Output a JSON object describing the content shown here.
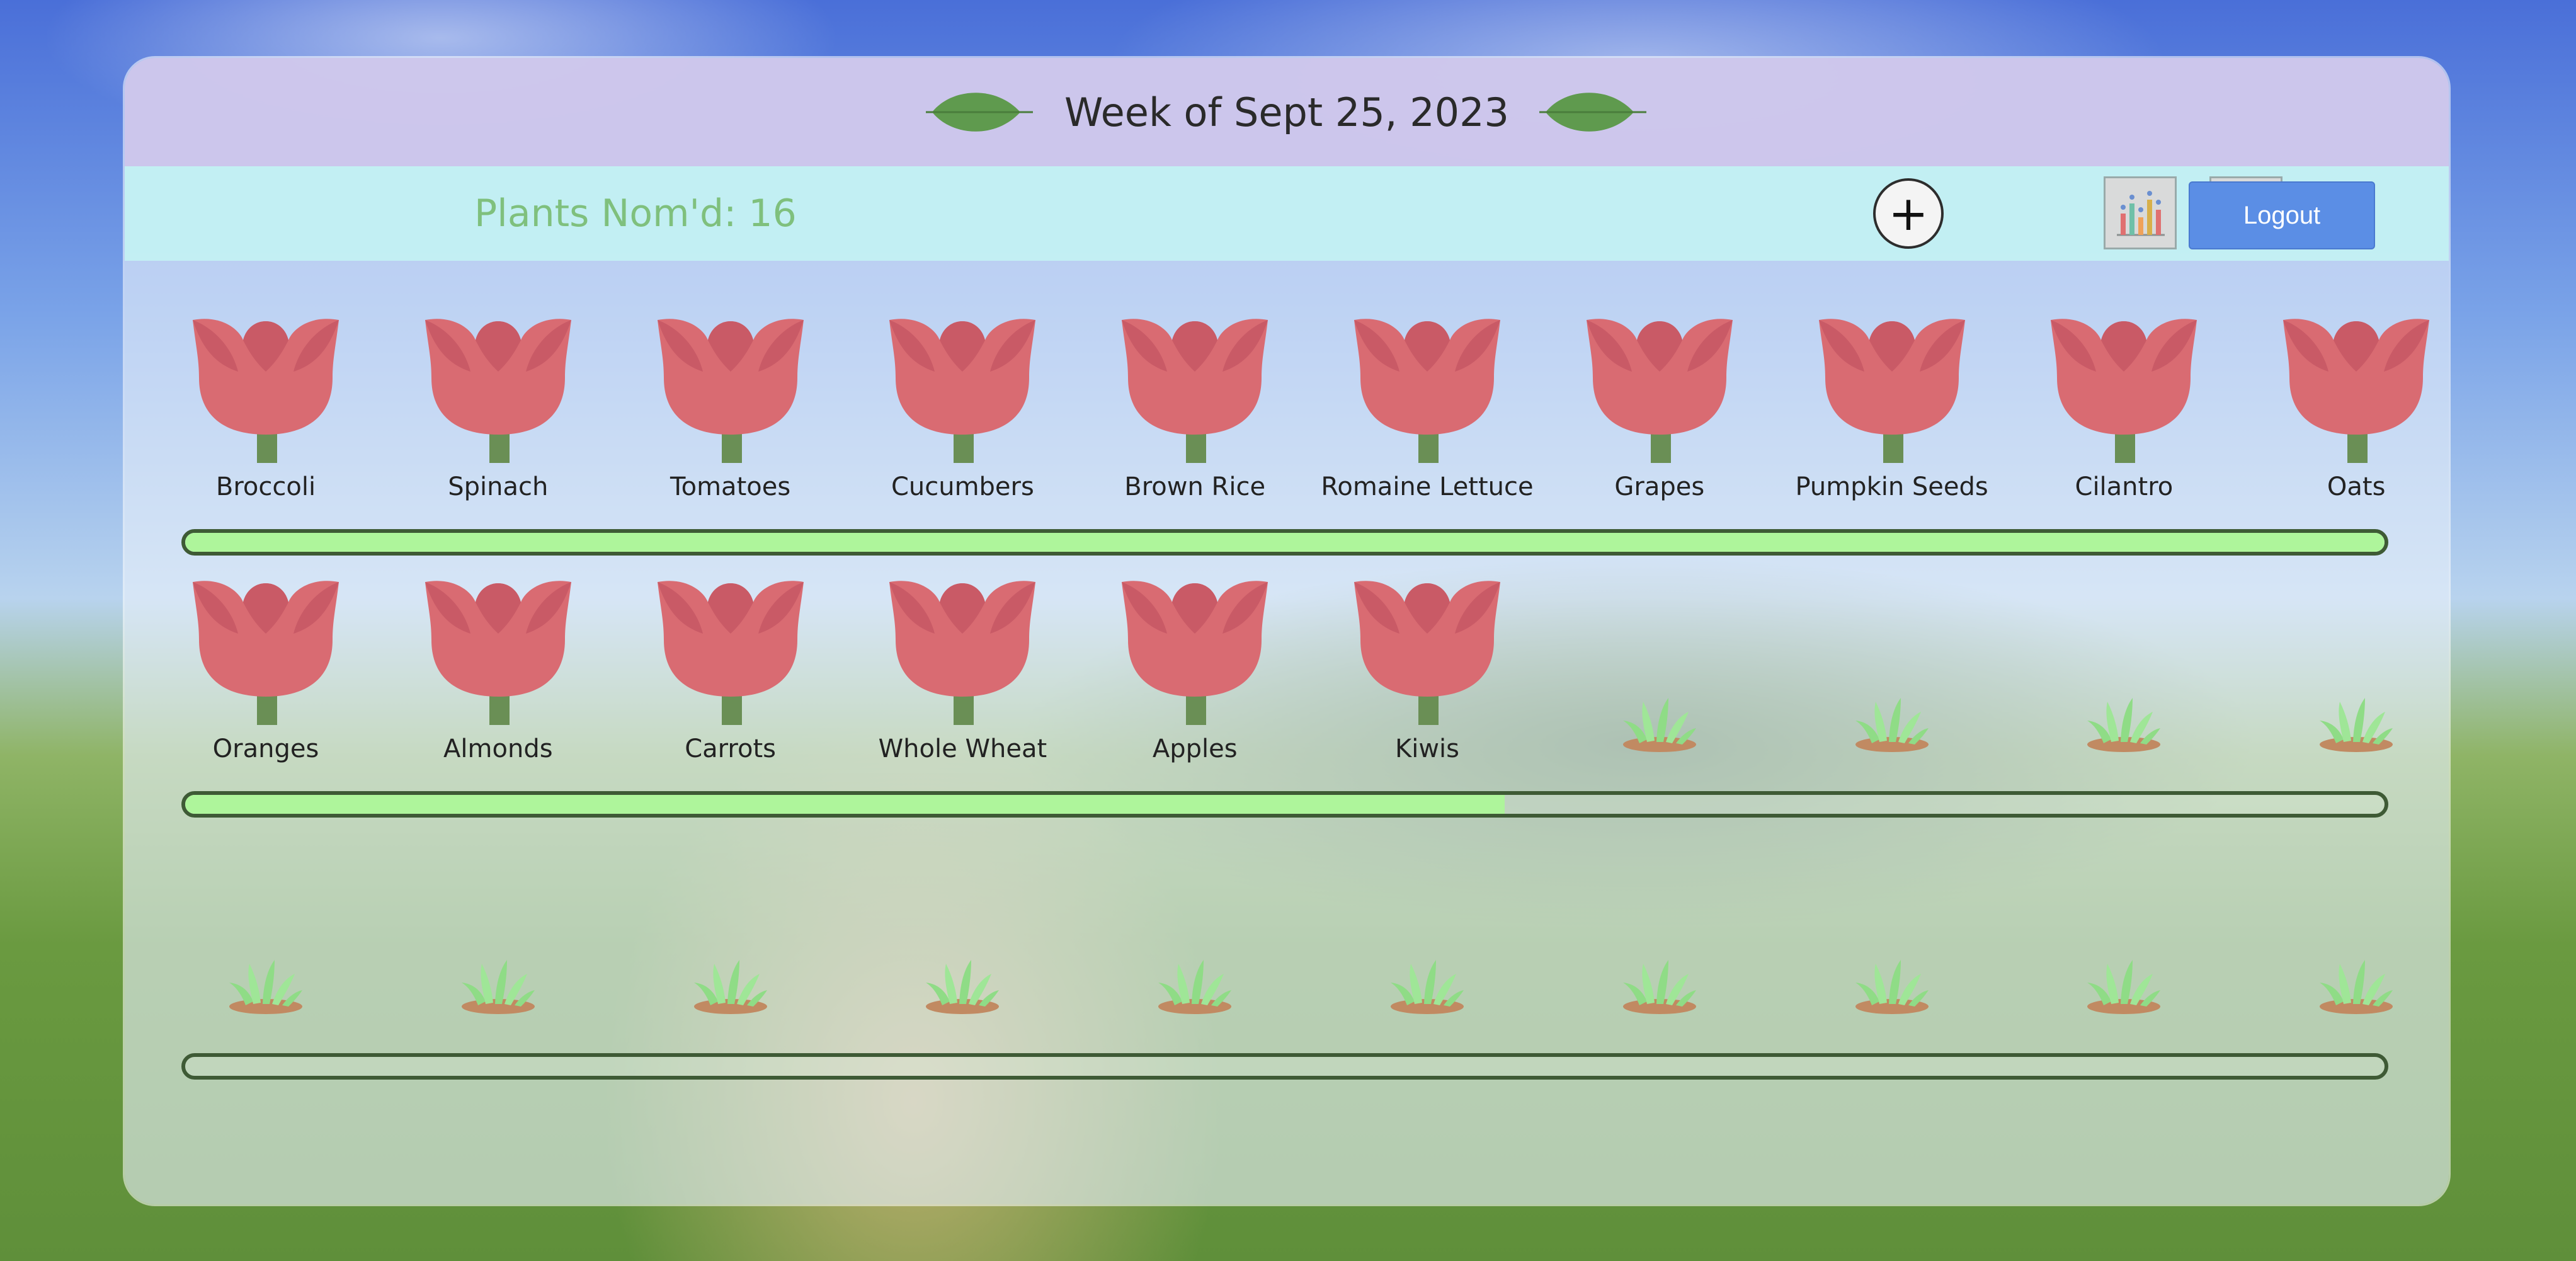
{
  "header": {
    "title": "Week of Sept 25, 2023"
  },
  "toolbar": {
    "count_text": "Plants Nom'd: 16",
    "add_label": "+",
    "logout_label": "Logout"
  },
  "rows": [
    {
      "plants": [
        "Broccoli",
        "Spinach",
        "Tomatoes",
        "Cucumbers",
        "Brown Rice",
        "Romaine Lettuce",
        "Grapes",
        "Pumpkin Seeds",
        "Cilantro",
        "Oats"
      ],
      "slots": 10,
      "progress": 1.0
    },
    {
      "plants": [
        "Oranges",
        "Almonds",
        "Carrots",
        "Whole Wheat",
        "Apples",
        "Kiwis"
      ],
      "slots": 10,
      "progress": 0.6
    },
    {
      "plants": [],
      "slots": 10,
      "progress": 0.0
    }
  ],
  "icons": {
    "bloom": "tulip-icon",
    "empty": "sprout-icon",
    "add": "plus-icon",
    "stats": "bar-chart-icon",
    "home": "home-icon",
    "header": "leaf-icon"
  },
  "colors": {
    "tulip": "#d96b72",
    "stem": "#6a8f55",
    "progress_fill": "#aef59b",
    "count_text": "#7fc07d",
    "logout_button": "#5b8ee5"
  }
}
